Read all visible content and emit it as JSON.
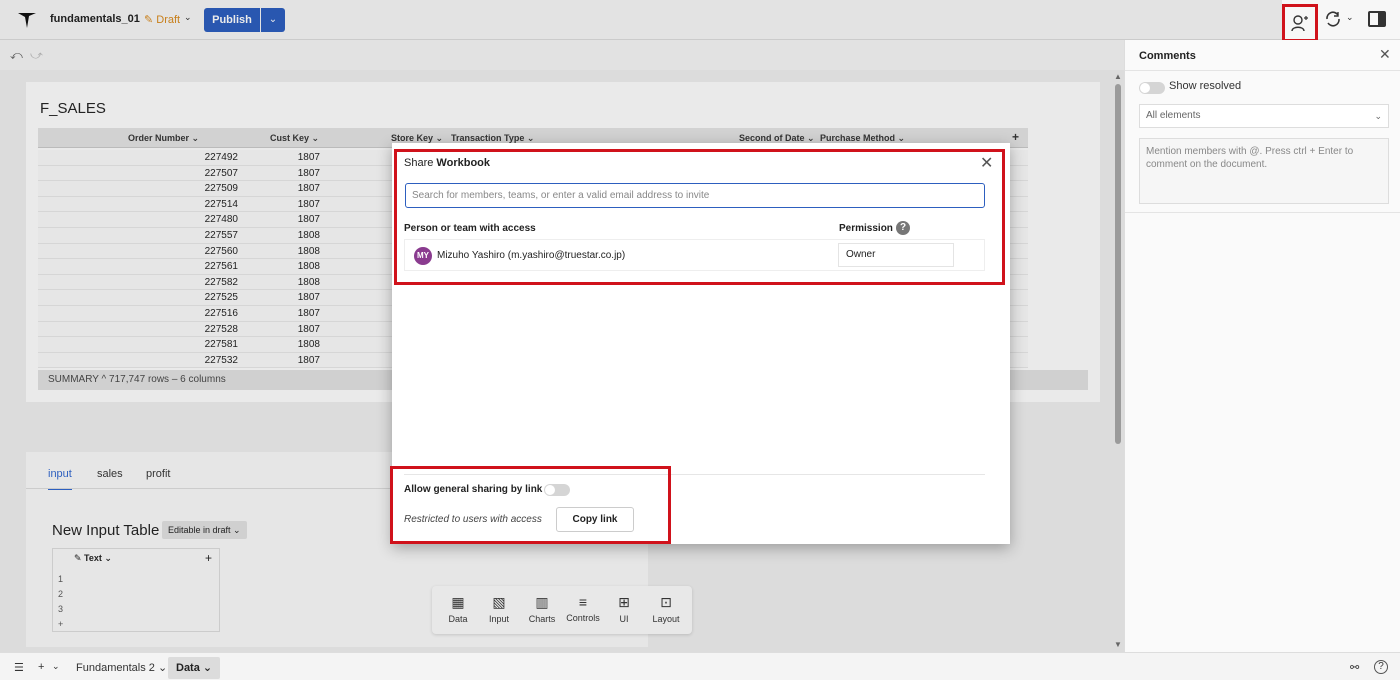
{
  "header": {
    "doc_title": "fundamentals_01",
    "draft_label": "Draft",
    "publish_label": "Publish"
  },
  "table": {
    "title": "F_SALES",
    "columns": [
      "Order Number",
      "Cust Key",
      "Store Key",
      "Transaction Type",
      "Second of Date",
      "Purchase Method"
    ],
    "rows": [
      [
        "227492",
        "1807"
      ],
      [
        "227507",
        "1807"
      ],
      [
        "227509",
        "1807"
      ],
      [
        "227514",
        "1807"
      ],
      [
        "227480",
        "1807"
      ],
      [
        "227557",
        "1808"
      ],
      [
        "227560",
        "1808"
      ],
      [
        "227561",
        "1808"
      ],
      [
        "227582",
        "1808"
      ],
      [
        "227525",
        "1807"
      ],
      [
        "227516",
        "1807"
      ],
      [
        "227528",
        "1807"
      ],
      [
        "227581",
        "1808"
      ],
      [
        "227532",
        "1807"
      ]
    ],
    "summary_label": "SUMMARY",
    "summary_text": "717,747 rows – 6 columns"
  },
  "lower": {
    "tabs": [
      "input",
      "sales",
      "profit"
    ],
    "input_title": "New Input Table",
    "editable_badge": "Editable in draft",
    "col_label": "Text",
    "row_numbers": [
      "1",
      "2",
      "3",
      "+"
    ]
  },
  "toolbar": {
    "items": [
      "Data",
      "Input",
      "Charts",
      "Controls",
      "UI",
      "Layout"
    ]
  },
  "bottom": {
    "page1": "Fundamentals 2",
    "page2": "Data"
  },
  "comments": {
    "title": "Comments",
    "show_resolved": "Show resolved",
    "filter": "All elements",
    "placeholder": "Mention members with @. Press ctrl + Enter to comment on the document."
  },
  "modal": {
    "title_prefix": "Share",
    "title_bold": "Workbook",
    "search_placeholder": "Search for members, teams, or enter a valid email address to invite",
    "col_person": "Person or team with access",
    "col_permission": "Permission",
    "person_initials": "MY",
    "person_name": "Mizuho Yashiro (m.yashiro@truestar.co.jp)",
    "person_permission": "Owner",
    "allow_sharing": "Allow general sharing by link",
    "restricted": "Restricted to users with access",
    "copy_link": "Copy link"
  },
  "colors": {
    "accent": "#2d5fbf",
    "highlight": "#d0121b",
    "draft": "#d98a1d",
    "avatar": "#8a3b8f"
  }
}
